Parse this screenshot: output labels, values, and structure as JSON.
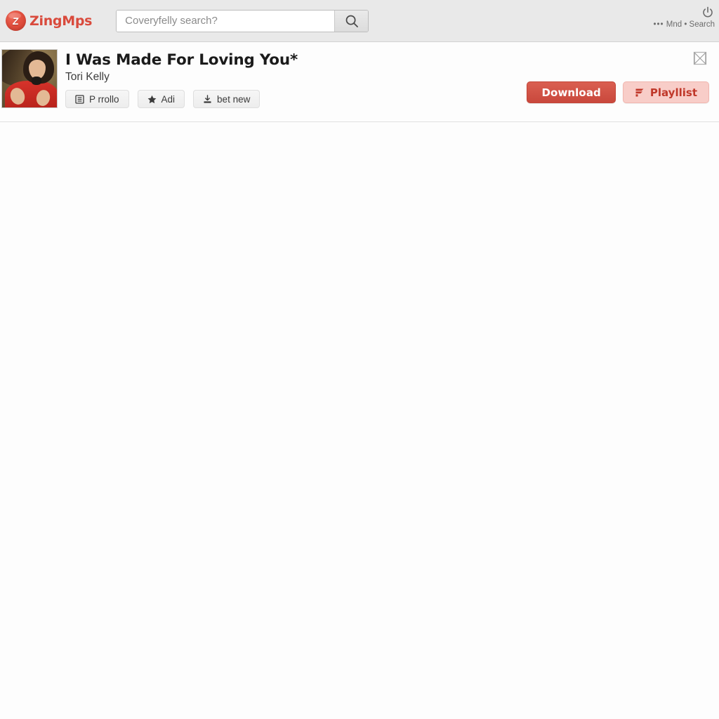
{
  "header": {
    "brand_mark": "Z",
    "brand_name": "ZingMps",
    "search": {
      "placeholder": "Coveryfelly search?",
      "value": "",
      "button_icon": "search-icon"
    },
    "power_icon": "power-icon",
    "meta_dots": "•••",
    "meta_text": "Mnd • Search"
  },
  "song": {
    "title": "I Was Made For Loving You*",
    "artist": "Tori Kelly",
    "cover_alt": "album-cover-artwork",
    "expand_icon": "expand-collapse-icon",
    "chips": [
      {
        "label": "P rrollo",
        "icon": "list-square-icon"
      },
      {
        "label": "Adi",
        "icon": "star-icon"
      },
      {
        "label": "bet new",
        "icon": "download-tray-icon"
      }
    ],
    "actions": {
      "download_label": "Download",
      "playlist_label": "Playllist",
      "playlist_icon": "flag-bars-icon"
    }
  },
  "colors": {
    "brand_red": "#d94a3c",
    "download_bg": "#c9483c",
    "playlist_bg": "#f8cdc8",
    "playlist_fg": "#c0382a",
    "topbar_bg": "#e9e9e9",
    "page_bg": "#fdfdfd"
  }
}
